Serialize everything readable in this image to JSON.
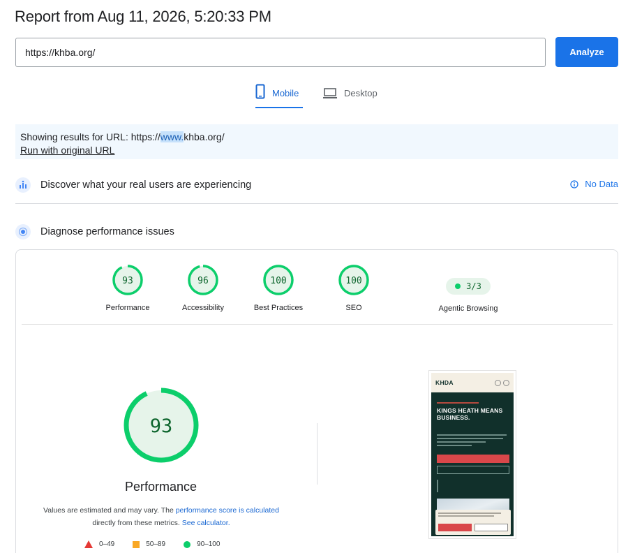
{
  "header": {
    "title": "Report from Aug 11, 2026, 5:20:33 PM"
  },
  "search": {
    "value": "https://khba.org/",
    "analyze_label": "Analyze"
  },
  "tabs": {
    "mobile": "Mobile",
    "desktop": "Desktop",
    "active": "Mobile"
  },
  "notice": {
    "prefix": "Showing results for URL: https://",
    "highlight": "www.",
    "suffix": "khba.org/",
    "link": "Run with original URL"
  },
  "sections": {
    "real_users": "Discover what your real users are experiencing",
    "no_data": "No Data",
    "diagnose": "Diagnose performance issues"
  },
  "scores": [
    {
      "label": "Performance",
      "value": "93",
      "color": "#0cce6b"
    },
    {
      "label": "Accessibility",
      "value": "96",
      "color": "#0cce6b"
    },
    {
      "label": "Best Practices",
      "value": "100",
      "color": "#0cce6b"
    },
    {
      "label": "SEO",
      "value": "100",
      "color": "#0cce6b"
    }
  ],
  "agentic": {
    "label": "Agentic Browsing",
    "value": "3/3"
  },
  "performance_detail": {
    "score": "93",
    "label": "Performance",
    "note_prefix": "Values are estimated and may vary. The ",
    "note_link1": "performance score is calculated",
    "note_mid": " directly from these metrics. ",
    "note_link2": "See calculator."
  },
  "legend": [
    {
      "shape": "triangle",
      "range": "0–49",
      "color": "#e53935"
    },
    {
      "shape": "square",
      "range": "50–89",
      "color": "#f9a825"
    },
    {
      "shape": "circle",
      "range": "90–100",
      "color": "#0cce6b"
    }
  ],
  "thumbnail": {
    "logo": "KHDA",
    "headline": "KINGS HEATH MEANS BUSINESS."
  },
  "colors": {
    "accent": "#1a73e8",
    "pass": "#0cce6b",
    "pass_text": "#0d652d"
  },
  "icons": {
    "mobile": "mobile-phone-icon",
    "desktop": "laptop-icon",
    "real_users": "crux-icon",
    "no_data": "info-icon",
    "diagnose": "lighthouse-icon"
  }
}
